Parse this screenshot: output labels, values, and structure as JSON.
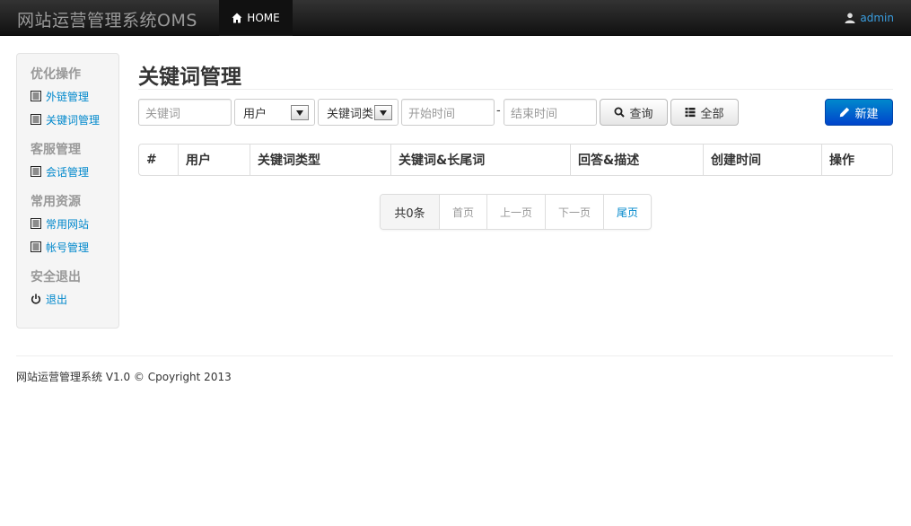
{
  "navbar": {
    "brand": "网站运营管理系统OMS",
    "home_label": "HOME",
    "user_label": "admin"
  },
  "sidebar": {
    "groups": [
      {
        "header": "优化操作",
        "items": [
          {
            "label": "外链管理",
            "icon": "list-icon"
          },
          {
            "label": "关键词管理",
            "icon": "list-icon"
          }
        ]
      },
      {
        "header": "客服管理",
        "items": [
          {
            "label": "会话管理",
            "icon": "list-icon"
          }
        ]
      },
      {
        "header": "常用资源",
        "items": [
          {
            "label": "常用网站",
            "icon": "list-icon"
          },
          {
            "label": "帐号管理",
            "icon": "list-icon"
          }
        ]
      },
      {
        "header": "安全退出",
        "items": [
          {
            "label": "退出",
            "icon": "power-icon"
          }
        ]
      }
    ]
  },
  "main": {
    "title": "关键词管理",
    "filters": {
      "keyword_placeholder": "关键词",
      "user_select": "用户",
      "type_select": "关键词类",
      "start_placeholder": "开始时间",
      "dash": "-",
      "end_placeholder": "结束时间",
      "query_label": "查询",
      "all_label": "全部",
      "new_label": "新建"
    },
    "table": {
      "columns": [
        "#",
        "用户",
        "关键词类型",
        "关键词&长尾词",
        "回答&描述",
        "创建时间",
        "操作"
      ]
    },
    "pagination": {
      "total": "共0条",
      "first": "首页",
      "prev": "上一页",
      "next": "下一页",
      "last": "尾页"
    }
  },
  "footer": {
    "text": "网站运营管理系统 V1.0 © Cpoyright 2013"
  },
  "colors": {
    "link": "#0088cc",
    "primary": "#0055cc",
    "navbar": "#1b1b1b"
  }
}
